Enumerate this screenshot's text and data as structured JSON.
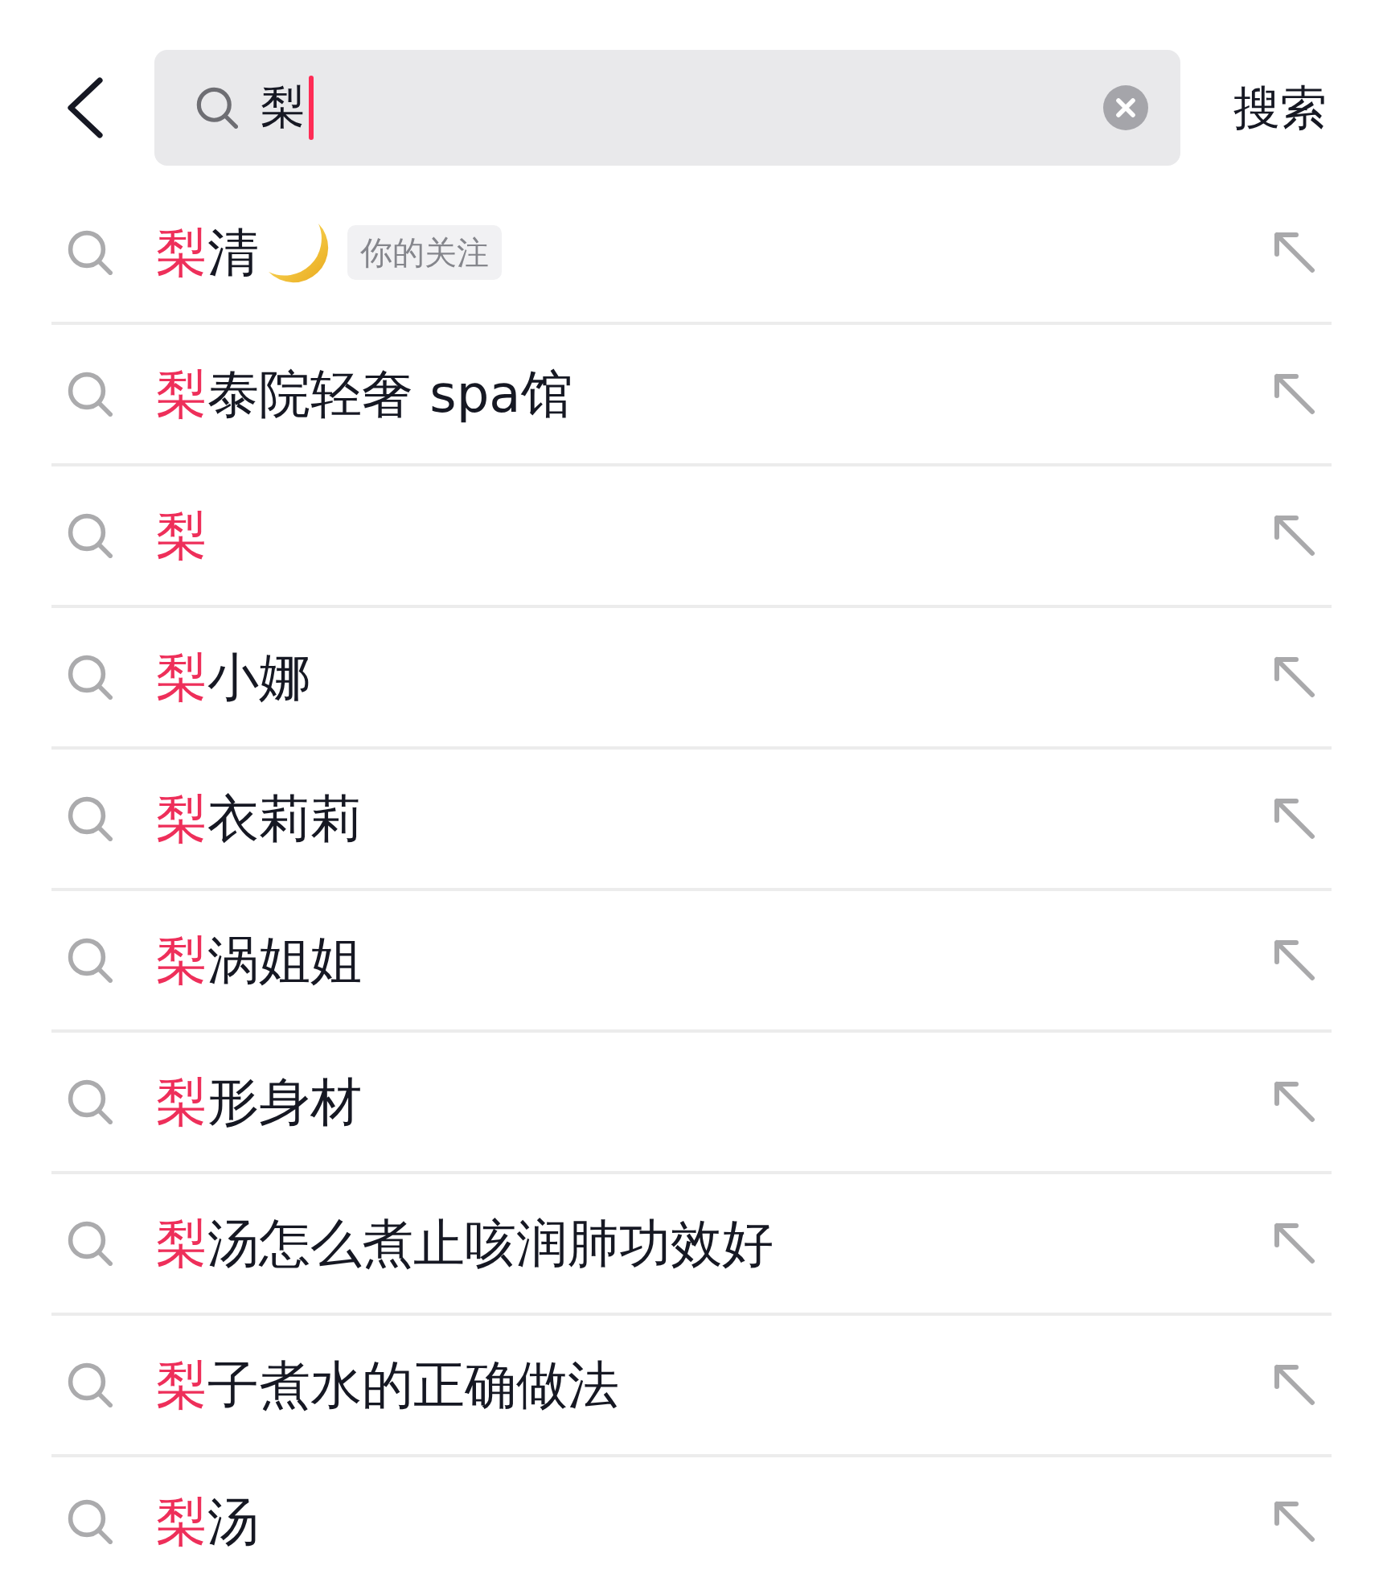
{
  "header": {
    "search_field": {
      "value": "梨",
      "focused": true
    },
    "search_button": "搜索"
  },
  "suggestions": [
    {
      "match": "梨",
      "rest": "清",
      "emoji": true,
      "badge": "你的关注"
    },
    {
      "match": "梨",
      "rest": "泰院轻奢 spa馆"
    },
    {
      "match": "梨"
    },
    {
      "match": "梨",
      "rest": "小娜"
    },
    {
      "match": "梨",
      "rest": "衣莉莉"
    },
    {
      "match": "梨",
      "rest": "涡姐姐"
    },
    {
      "match": "梨",
      "rest": "形身材"
    },
    {
      "match": "梨",
      "rest": "汤怎么煮止咳润肺功效好"
    },
    {
      "match": "梨",
      "rest": "子煮水的正确做法"
    },
    {
      "match": "梨",
      "rest": "汤"
    }
  ]
}
